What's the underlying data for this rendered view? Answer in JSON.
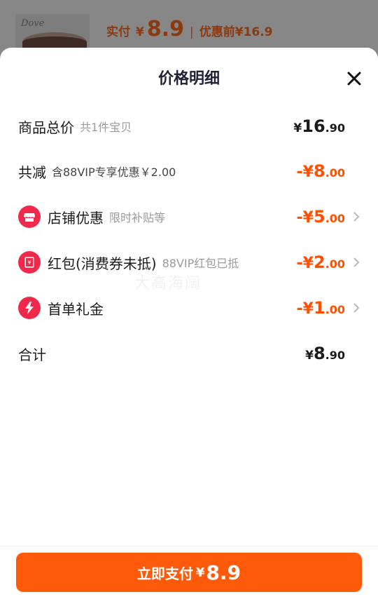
{
  "background_product": {
    "logo_text": "Dove",
    "paid_label": "实付",
    "paid_yen": "¥",
    "paid_amount": "8.9",
    "before_label": "优惠前¥16.9"
  },
  "sheet": {
    "title": "价格明细",
    "close_icon": "close-icon"
  },
  "rows": {
    "total": {
      "label": "商品总价",
      "sub": "共1件宝贝",
      "yen": "¥",
      "int": "16",
      "frac": ".90"
    },
    "reduce": {
      "label": "共减",
      "sub": "含88VIP专享优惠￥2.00",
      "sign": "-¥",
      "int": "8",
      "frac": ".00"
    },
    "store": {
      "icon": "store-icon",
      "label": "店铺优惠",
      "sub": "限时补贴等",
      "sign": "-¥",
      "int": "5",
      "frac": ".00"
    },
    "redpacket": {
      "icon": "red-packet-icon",
      "label": "红包(消费券未抵)",
      "sub": "88VIP红包已抵",
      "sign": "-¥",
      "int": "2",
      "frac": ".00"
    },
    "firstorder": {
      "icon": "lightning-icon",
      "label": "首单礼金",
      "sub": "",
      "sign": "-¥",
      "int": "1",
      "frac": ".00"
    },
    "sum": {
      "label": "合计",
      "yen": "¥",
      "int": "8",
      "frac": ".90"
    }
  },
  "watermark": "大高海阔",
  "pay_button": {
    "label": "立即支付",
    "yen": "¥",
    "amount": "8.9"
  },
  "colors": {
    "accent": "#ff5000",
    "button": "#ff5a0a",
    "icon_red": "#f0284a"
  }
}
